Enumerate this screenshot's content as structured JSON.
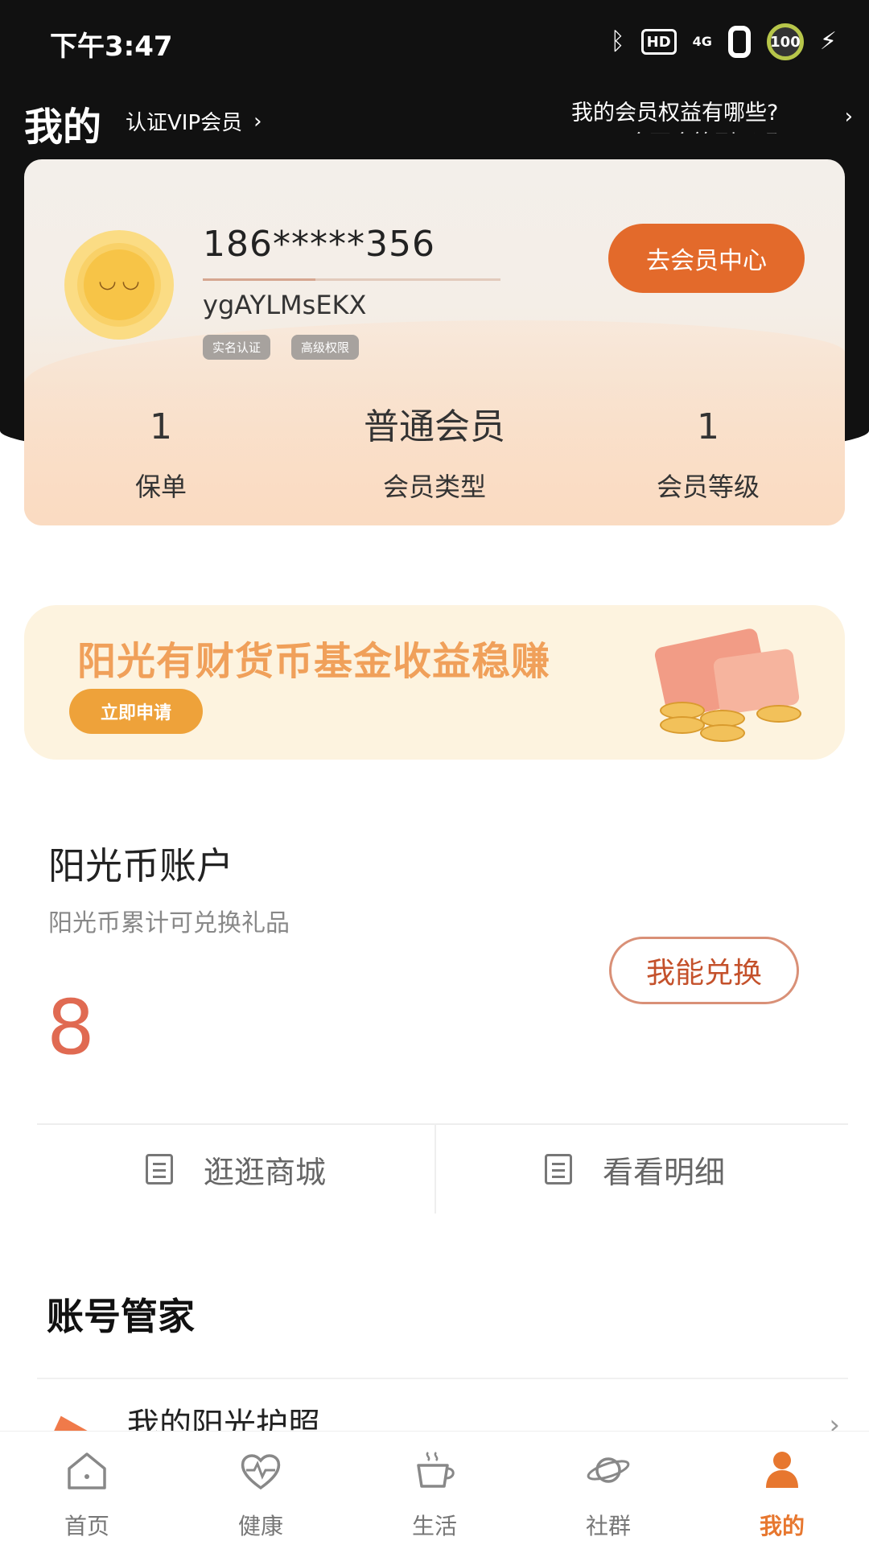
{
  "status_bar": {
    "time": "下午3:47",
    "hd": "HD",
    "network": "4G",
    "battery": "100"
  },
  "header": {
    "title": "我的",
    "vip_link": "认证VIP会员",
    "benefits_line1": "我的会员权益有哪些?",
    "benefits_line2": "会不会等到了吗?"
  },
  "profile": {
    "phone": "186*****356",
    "username": "ygAYLMsEKX",
    "tags": [
      "实名认证",
      "高级权限"
    ],
    "member_center_label": "去会员中心",
    "stats": [
      {
        "value": "1",
        "label": "保单"
      },
      {
        "value": "普通会员",
        "label": "会员类型"
      },
      {
        "value": "1",
        "label": "会员等级"
      }
    ]
  },
  "banner": {
    "title": "阳光有财货币基金收益稳赚",
    "button": "立即申请"
  },
  "coin_account": {
    "title": "阳光币账户",
    "subtitle": "阳光币累计可兑换礼品",
    "count": "8",
    "redeem_label": "我能兑换",
    "actions": [
      {
        "label": "逛逛商城"
      },
      {
        "label": "看看明细"
      }
    ]
  },
  "account_manager": {
    "title": "账号管家",
    "items": [
      {
        "label": "我的阳光护照"
      }
    ]
  },
  "nav": {
    "items": [
      {
        "label": "首页",
        "icon": "home-icon"
      },
      {
        "label": "健康",
        "icon": "heart-pulse-icon"
      },
      {
        "label": "生活",
        "icon": "cup-icon"
      },
      {
        "label": "社群",
        "icon": "planet-icon"
      },
      {
        "label": "我的",
        "icon": "person-icon"
      }
    ],
    "active_index": 4,
    "active_color": "#e7772f"
  },
  "colors": {
    "accent": "#e36a2b",
    "coin_count": "#e06a52",
    "banner_text": "#f0a05a"
  }
}
